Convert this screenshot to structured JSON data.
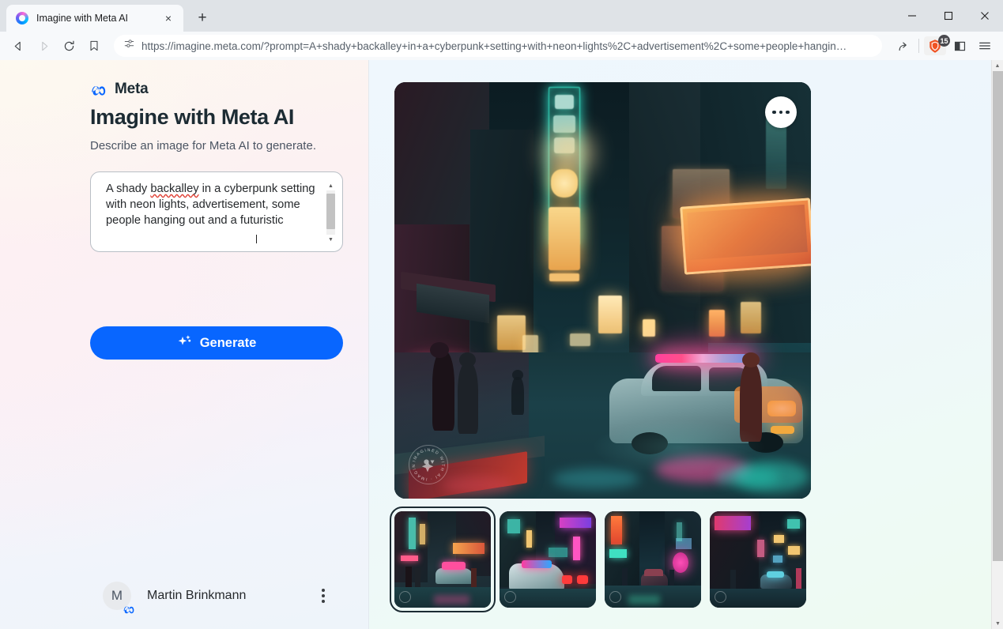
{
  "browser": {
    "tab": {
      "title": "Imagine with Meta AI",
      "favicon": "meta-ai-ring-icon",
      "close": "×"
    },
    "new_tab_label": "+",
    "window_controls": {
      "minimize": "minimize-icon",
      "maximize": "maximize-icon",
      "close": "close-icon"
    },
    "nav": {
      "back": "back-arrow-icon",
      "forward": "forward-arrow-icon",
      "reload": "reload-icon",
      "bookmark": "bookmark-icon"
    },
    "omnibox": {
      "permission_icon": "site-permissions-icon",
      "url": "https://imagine.meta.com/?prompt=A+shady+backalley+in+a+cyberpunk+setting+with+neon+lights%2C+advertisement%2C+some+people+hangin…",
      "share_icon": "share-icon"
    },
    "shield": {
      "icon": "brave-shield-icon",
      "badge_count": "15"
    },
    "split_view_icon": "split-view-icon",
    "menu_icon": "hamburger-menu-icon"
  },
  "sidebar": {
    "brand": {
      "mark": "meta-infinity-logo",
      "word": "Meta"
    },
    "headline": "Imagine with Meta AI",
    "subhead": "Describe an image for Meta AI to generate.",
    "prompt": {
      "text_part1": "A shady ",
      "misspelled": "backalley",
      "text_part2": " in a cyberpunk setting with neon lights, advertisement, some people hanging out and a futuristic",
      "scrollbar": "prompt-scrollbar"
    },
    "generate": {
      "label": "Generate",
      "icon": "sparkle-icon",
      "color": "#0866ff"
    },
    "user": {
      "initial": "M",
      "name": "Martin Brinkmann",
      "badge": "meta-badge-icon",
      "menu_icon": "kebab-menu-icon"
    }
  },
  "main": {
    "hero": {
      "alt": "cyberpunk-backalley-with-police-car",
      "menu_icon": "more-options-icon",
      "watermark": "imagined-with-ai-watermark"
    },
    "thumbnails": [
      {
        "alt": "cyberpunk-alley-variation-1",
        "selected": true
      },
      {
        "alt": "cyberpunk-alley-variation-2",
        "selected": false
      },
      {
        "alt": "cyberpunk-alley-variation-3",
        "selected": false
      },
      {
        "alt": "cyberpunk-alley-variation-4",
        "selected": false
      }
    ]
  },
  "colors": {
    "accent": "#0866ff",
    "brand_text": "#1c2b33",
    "left_bg": "#fdf6f0",
    "right_bg": "#eff7fd"
  }
}
